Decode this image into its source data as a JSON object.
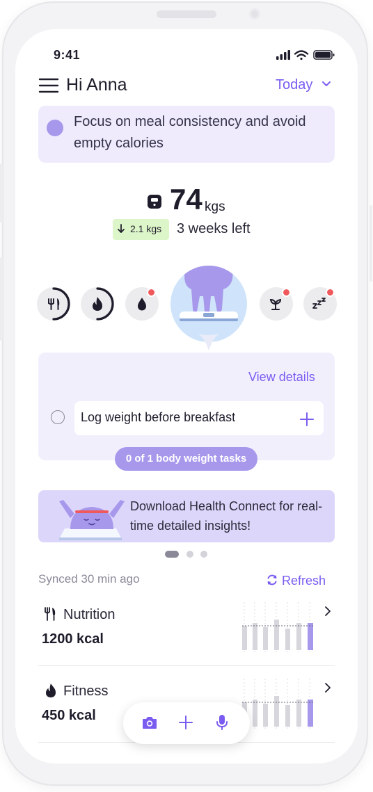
{
  "status": {
    "time": "9:41"
  },
  "header": {
    "greeting": "Hi Anna",
    "period_label": "Today"
  },
  "focus": {
    "message": "Focus on meal consistency and avoid empty calories"
  },
  "weight": {
    "value": "74",
    "unit": "kgs",
    "change": "2.1 kgs",
    "change_direction": "down",
    "time_left": "3 weeks left"
  },
  "trackers": [
    {
      "name": "nutrition",
      "icon": "fork-knife-icon",
      "progress": 0.45,
      "notification": false
    },
    {
      "name": "fitness",
      "icon": "flame-icon",
      "progress": 0.5,
      "notification": false
    },
    {
      "name": "water",
      "icon": "water-drop-icon",
      "progress": 0,
      "notification": true
    },
    {
      "name": "weight",
      "icon": "scale-person-icon",
      "selected": true
    },
    {
      "name": "plant",
      "icon": "sprout-icon",
      "progress": 0,
      "notification": true
    },
    {
      "name": "sleep",
      "icon": "sleep-zzz-icon",
      "progress": 0,
      "notification": true
    }
  ],
  "tasks": {
    "view_details": "View details",
    "items": [
      {
        "label": "Log weight before breakfast",
        "done": false
      }
    ],
    "summary": "0 of 1 body weight tasks"
  },
  "banner": {
    "text": "Download Health Connect for real-time detailed insights!",
    "pages": 3,
    "active_page": 0
  },
  "sync": {
    "status": "Synced 30 min ago",
    "refresh_label": "Refresh"
  },
  "metrics": [
    {
      "label": "Nutrition",
      "icon": "fork-knife-icon",
      "value": "1200 kcal"
    },
    {
      "label": "Fitness",
      "icon": "flame-icon",
      "value": "450 kcal"
    }
  ],
  "bottom_bar": {
    "actions": [
      "camera-icon",
      "plus-icon",
      "microphone-icon"
    ]
  },
  "colors": {
    "accent": "#7b5cf0",
    "lavender": "#a798ec",
    "card": "#f2effd",
    "badge_green": "#dcf5c9",
    "alert": "#f0595c"
  }
}
